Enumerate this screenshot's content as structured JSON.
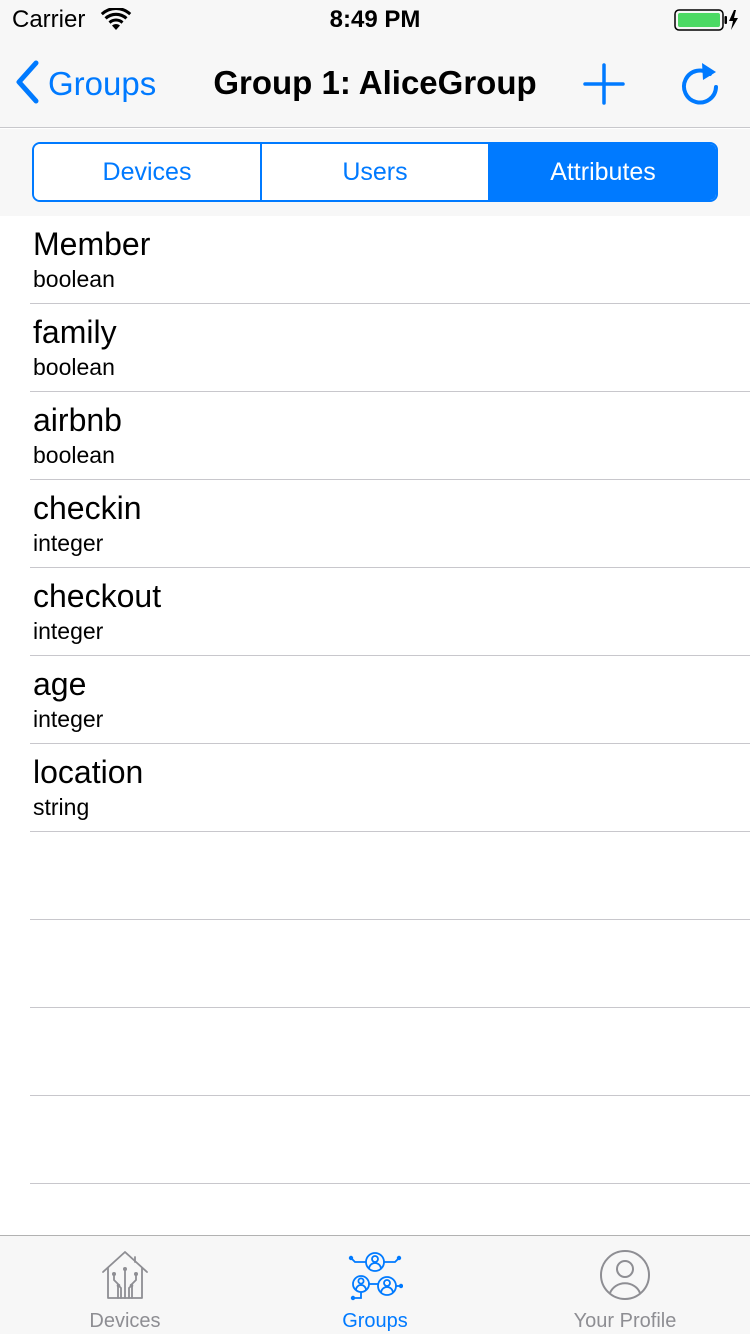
{
  "status_bar": {
    "carrier": "Carrier",
    "time": "8:49 PM",
    "battery_color": "#4cd964"
  },
  "nav": {
    "back_label": "Groups",
    "title": "Group 1: AliceGroup"
  },
  "segments": [
    {
      "label": "Devices",
      "active": false
    },
    {
      "label": "Users",
      "active": false
    },
    {
      "label": "Attributes",
      "active": true
    }
  ],
  "attributes": [
    {
      "name": "Member",
      "type": "boolean"
    },
    {
      "name": "family",
      "type": "boolean"
    },
    {
      "name": "airbnb",
      "type": "boolean"
    },
    {
      "name": "checkin",
      "type": "integer"
    },
    {
      "name": "checkout",
      "type": "integer"
    },
    {
      "name": "age",
      "type": "integer"
    },
    {
      "name": "location",
      "type": "string"
    }
  ],
  "tab_bar": {
    "tabs": [
      {
        "label": "Devices",
        "icon": "smart-home-icon",
        "active": false
      },
      {
        "label": "Groups",
        "icon": "group-network-icon",
        "active": true
      },
      {
        "label": "Your Profile",
        "icon": "profile-icon",
        "active": false
      }
    ]
  },
  "colors": {
    "accent": "#007aff",
    "inactive_tab": "#8e8e93",
    "bar_background": "#f7f7f7"
  }
}
